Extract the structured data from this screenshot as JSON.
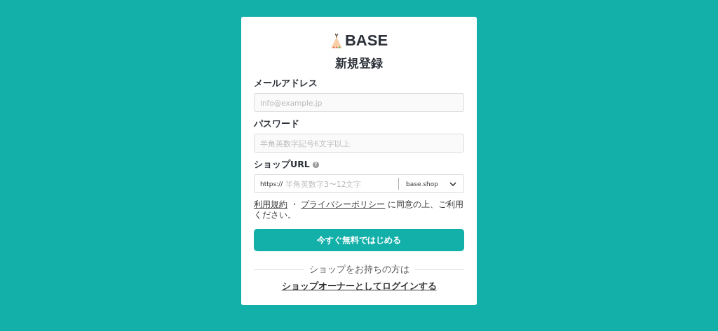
{
  "logo": {
    "text": "BASE"
  },
  "title": "新規登録",
  "fields": [
    {
      "kind": "text",
      "label": "メールアドレス",
      "placeholder": "info@example.jp"
    },
    {
      "kind": "text",
      "label": "パスワード",
      "placeholder": "半角英数字記号6文字以上"
    },
    {
      "kind": "url",
      "label": "ショップURL",
      "help": "?",
      "prefix": "https://",
      "placeholder": "半角英数字3〜12文字",
      "domain": "base.shop"
    }
  ],
  "terms": [
    {
      "kind": "link",
      "text": "利用規約"
    },
    {
      "kind": "text",
      "text": " ・ "
    },
    {
      "kind": "link",
      "text": "プライバシーポリシー"
    },
    {
      "kind": "text",
      "text": " に同意の上、ご利用ください。"
    }
  ],
  "submit_button": "今すぐ無料ではじめる",
  "divider_text": "ショップをお持ちの方は",
  "login_link": "ショップオーナーとしてログインする"
}
